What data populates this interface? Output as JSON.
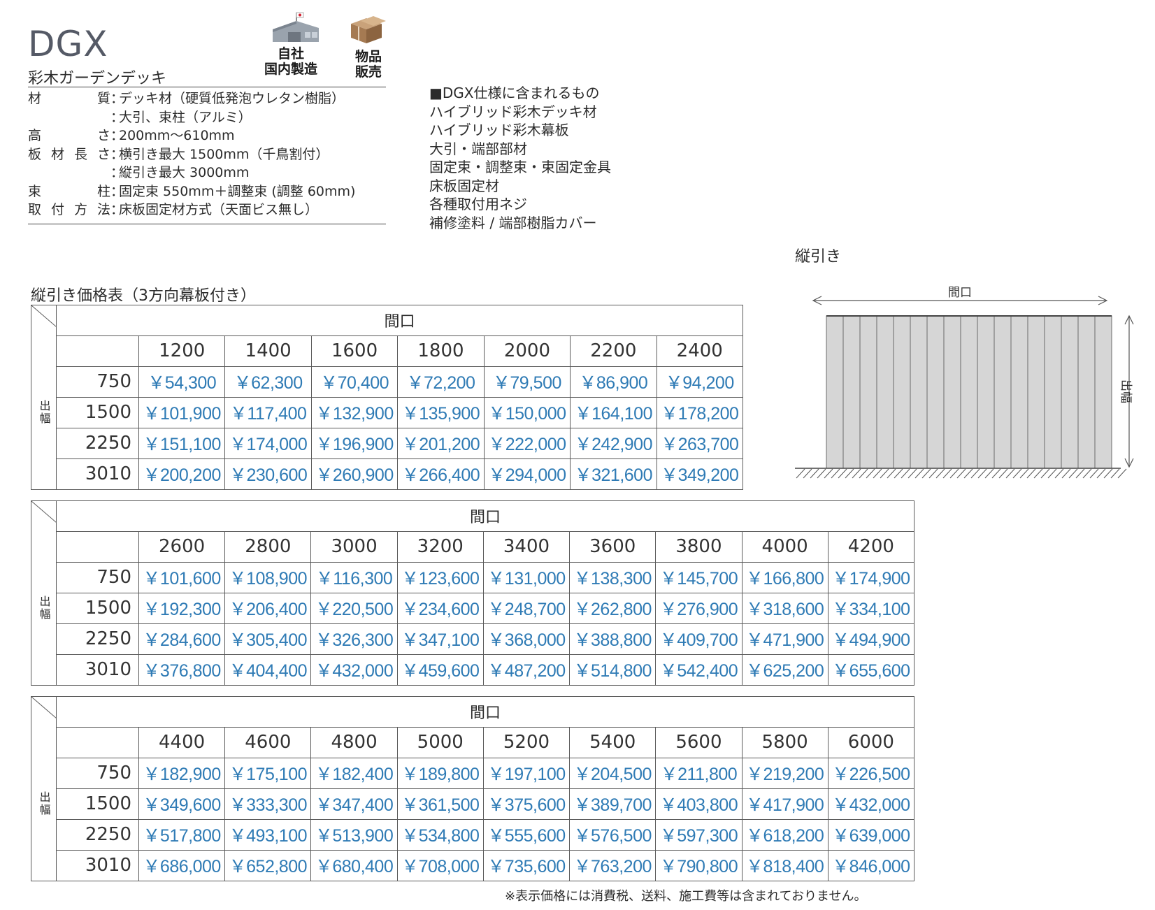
{
  "product": {
    "code": "DGX",
    "name": "彩木ガーデンデッキ",
    "badges": [
      "自社\n国内製造",
      "物品\n販売"
    ]
  },
  "specs": [
    {
      "label": "材質",
      "value": "デッキ材（硬質低発泡ウレタン樹脂）"
    },
    {
      "label": "",
      "value": "大引、束柱（アルミ）"
    },
    {
      "label": "高さ",
      "value": "200mm〜610mm"
    },
    {
      "label": "板材長さ",
      "value": "横引き最大 1500mm（千鳥割付）"
    },
    {
      "label": "",
      "value": "縦引き最大 3000mm"
    },
    {
      "label": "束柱",
      "value": "固定束 550mm＋調整束 (調整 60mm)"
    },
    {
      "label": "取付方法",
      "value": "床板固定材方式（天面ビス無し）"
    }
  ],
  "included": {
    "heading": "■DGX仕様に含まれるもの",
    "items": [
      "ハイブリッド彩木デッキ材",
      "ハイブリッド彩木幕板",
      "大引・端部部材",
      "固定束・調整束・束固定金具",
      "床板固定材",
      "各種取付用ネジ",
      "補修塗料 / 端部樹脂カバー"
    ]
  },
  "price_table_title": "縦引き価格表（3方向幕板付き）",
  "diagram": {
    "title": "縦引き",
    "width_label": "間口",
    "depth_label": "出幅"
  },
  "tables": [
    {
      "width_header": "間口",
      "depth_header": "出幅",
      "widths": [
        "1200",
        "1400",
        "1600",
        "1800",
        "2000",
        "2200",
        "2400"
      ],
      "rows": [
        {
          "depth": "750",
          "prices": [
            "￥54,300",
            "￥62,300",
            "￥70,400",
            "￥72,200",
            "￥79,500",
            "￥86,900",
            "￥94,200"
          ]
        },
        {
          "depth": "1500",
          "prices": [
            "￥101,900",
            "￥117,400",
            "￥132,900",
            "￥135,900",
            "￥150,000",
            "￥164,100",
            "￥178,200"
          ]
        },
        {
          "depth": "2250",
          "prices": [
            "￥151,100",
            "￥174,000",
            "￥196,900",
            "￥201,200",
            "￥222,000",
            "￥242,900",
            "￥263,700"
          ]
        },
        {
          "depth": "3010",
          "prices": [
            "￥200,200",
            "￥230,600",
            "￥260,900",
            "￥266,400",
            "￥294,000",
            "￥321,600",
            "￥349,200"
          ]
        }
      ]
    },
    {
      "width_header": "間口",
      "depth_header": "出幅",
      "widths": [
        "2600",
        "2800",
        "3000",
        "3200",
        "3400",
        "3600",
        "3800",
        "4000",
        "4200"
      ],
      "rows": [
        {
          "depth": "750",
          "prices": [
            "￥101,600",
            "￥108,900",
            "￥116,300",
            "￥123,600",
            "￥131,000",
            "￥138,300",
            "￥145,700",
            "￥166,800",
            "￥174,900"
          ]
        },
        {
          "depth": "1500",
          "prices": [
            "￥192,300",
            "￥206,400",
            "￥220,500",
            "￥234,600",
            "￥248,700",
            "￥262,800",
            "￥276,900",
            "￥318,600",
            "￥334,100"
          ]
        },
        {
          "depth": "2250",
          "prices": [
            "￥284,600",
            "￥305,400",
            "￥326,300",
            "￥347,100",
            "￥368,000",
            "￥388,800",
            "￥409,700",
            "￥471,900",
            "￥494,900"
          ]
        },
        {
          "depth": "3010",
          "prices": [
            "￥376,800",
            "￥404,400",
            "￥432,000",
            "￥459,600",
            "￥487,200",
            "￥514,800",
            "￥542,400",
            "￥625,200",
            "￥655,600"
          ]
        }
      ]
    },
    {
      "width_header": "間口",
      "depth_header": "出幅",
      "widths": [
        "4400",
        "4600",
        "4800",
        "5000",
        "5200",
        "5400",
        "5600",
        "5800",
        "6000"
      ],
      "rows": [
        {
          "depth": "750",
          "prices": [
            "￥182,900",
            "￥175,100",
            "￥182,400",
            "￥189,800",
            "￥197,100",
            "￥204,500",
            "￥211,800",
            "￥219,200",
            "￥226,500"
          ]
        },
        {
          "depth": "1500",
          "prices": [
            "￥349,600",
            "￥333,300",
            "￥347,400",
            "￥361,500",
            "￥375,600",
            "￥389,700",
            "￥403,800",
            "￥417,900",
            "￥432,000"
          ]
        },
        {
          "depth": "2250",
          "prices": [
            "￥517,800",
            "￥493,100",
            "￥513,900",
            "￥534,800",
            "￥555,600",
            "￥576,500",
            "￥597,300",
            "￥618,200",
            "￥639,000"
          ]
        },
        {
          "depth": "3010",
          "prices": [
            "￥686,000",
            "￥652,800",
            "￥680,400",
            "￥708,000",
            "￥735,600",
            "￥763,200",
            "￥790,800",
            "￥818,400",
            "￥846,000"
          ]
        }
      ]
    }
  ],
  "footnote": "※表示価格には消費税、送料、施工費等は含まれておりません。",
  "colors": {
    "price": "#2f7bb5",
    "title": "#555a66",
    "panel": "#d6d6d6"
  }
}
